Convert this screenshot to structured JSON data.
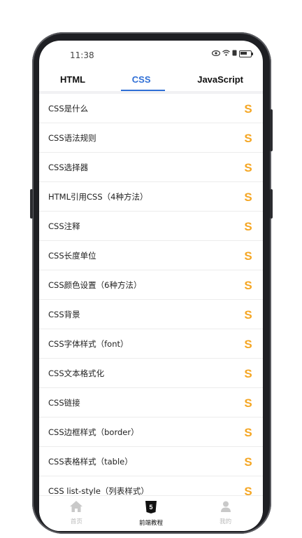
{
  "status_bar": {
    "time": "11:38"
  },
  "tabs": [
    {
      "label": "HTML",
      "active": false
    },
    {
      "label": "CSS",
      "active": true
    },
    {
      "label": "JavaScript",
      "active": false
    }
  ],
  "list": {
    "items": [
      {
        "label": "CSS是什么"
      },
      {
        "label": "CSS语法规则"
      },
      {
        "label": "CSS选择器"
      },
      {
        "label": "HTML引用CSS（4种方法）"
      },
      {
        "label": "CSS注释"
      },
      {
        "label": "CSS长度单位"
      },
      {
        "label": "CSS颜色设置（6种方法）"
      },
      {
        "label": "CSS背景"
      },
      {
        "label": "CSS字体样式（font）"
      },
      {
        "label": "CSS文本格式化"
      },
      {
        "label": "CSS链接"
      },
      {
        "label": "CSS边框样式（border）"
      },
      {
        "label": "CSS表格样式（table）"
      },
      {
        "label": "CSS list-style（列表样式）"
      }
    ],
    "item_icon": "dollar-s-icon"
  },
  "bottom_nav": {
    "items": [
      {
        "label": "首页",
        "icon": "home-icon",
        "active": false
      },
      {
        "label": "前端教程",
        "icon": "html5-icon",
        "active": true
      },
      {
        "label": "我的",
        "icon": "user-icon",
        "active": false
      }
    ]
  },
  "colors": {
    "accent": "#2f6fd6",
    "item_icon": "#f5a623",
    "inactive_nav": "#bbbbbb"
  }
}
